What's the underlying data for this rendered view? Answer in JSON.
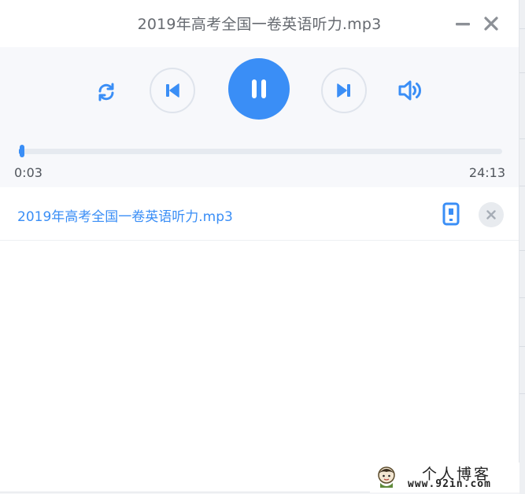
{
  "window": {
    "title": "2019年高考全国一卷英语听力.mp3"
  },
  "player": {
    "current_time": "0:03",
    "total_time": "24:13",
    "progress_fraction": 0.002,
    "state": "playing",
    "accent_color": "#3a8ef6"
  },
  "playlist": {
    "items": [
      {
        "title": "2019年高考全国一卷英语听力.mp3"
      }
    ]
  },
  "watermark": {
    "title": "个人博客",
    "url": "www.92in.com"
  },
  "icons": {
    "minimize": "minimize-icon",
    "close": "close-icon",
    "loop": "loop-icon",
    "previous": "skip-previous-icon",
    "pause": "pause-icon",
    "next": "skip-next-icon",
    "volume": "volume-icon",
    "device": "phone-icon",
    "remove": "close-icon"
  }
}
